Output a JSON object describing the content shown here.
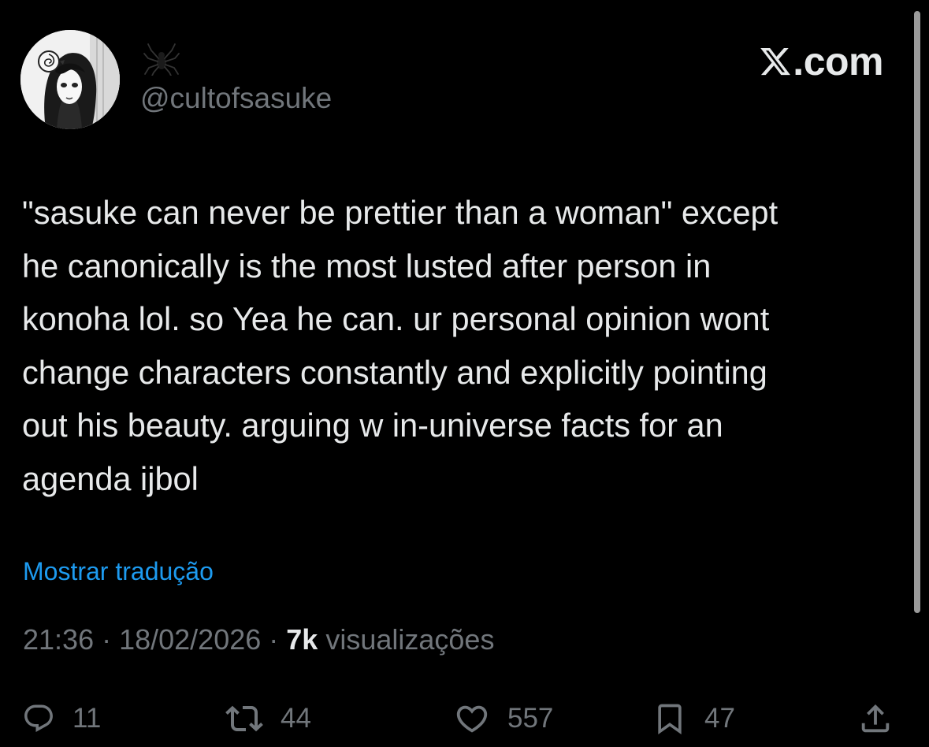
{
  "author": {
    "display_name_icon": "spider-icon",
    "handle": "@cultofsasuke",
    "avatar": "avatar-image"
  },
  "brand": {
    "logo_icon": "x-logo-icon",
    "text": ".com"
  },
  "tweet": {
    "lines": [
      "\"sasuke can never be prettier than a woman\" except",
      "he canonically is the most lusted after person in",
      "konoha lol. so Yea he can. ur personal opinion wont",
      "change characters constantly and explicitly pointing",
      "out his beauty. arguing w in-universe facts for an",
      "agenda ijbol"
    ],
    "translate_label": "Mostrar tradução"
  },
  "meta": {
    "time": "21:36",
    "separator": " · ",
    "date": "18/02/2026",
    "views_count": "7k",
    "views_label": "visualizações"
  },
  "actions": {
    "reply": {
      "icon": "reply-icon",
      "count": "11"
    },
    "repost": {
      "icon": "repost-icon",
      "count": "44"
    },
    "like": {
      "icon": "heart-icon",
      "count": "557"
    },
    "bookmark": {
      "icon": "bookmark-icon",
      "count": "47"
    },
    "share": {
      "icon": "share-icon"
    }
  },
  "colors": {
    "background": "#000000",
    "text": "#e7e9ea",
    "secondary": "#71767b",
    "link": "#1d9bf0"
  }
}
